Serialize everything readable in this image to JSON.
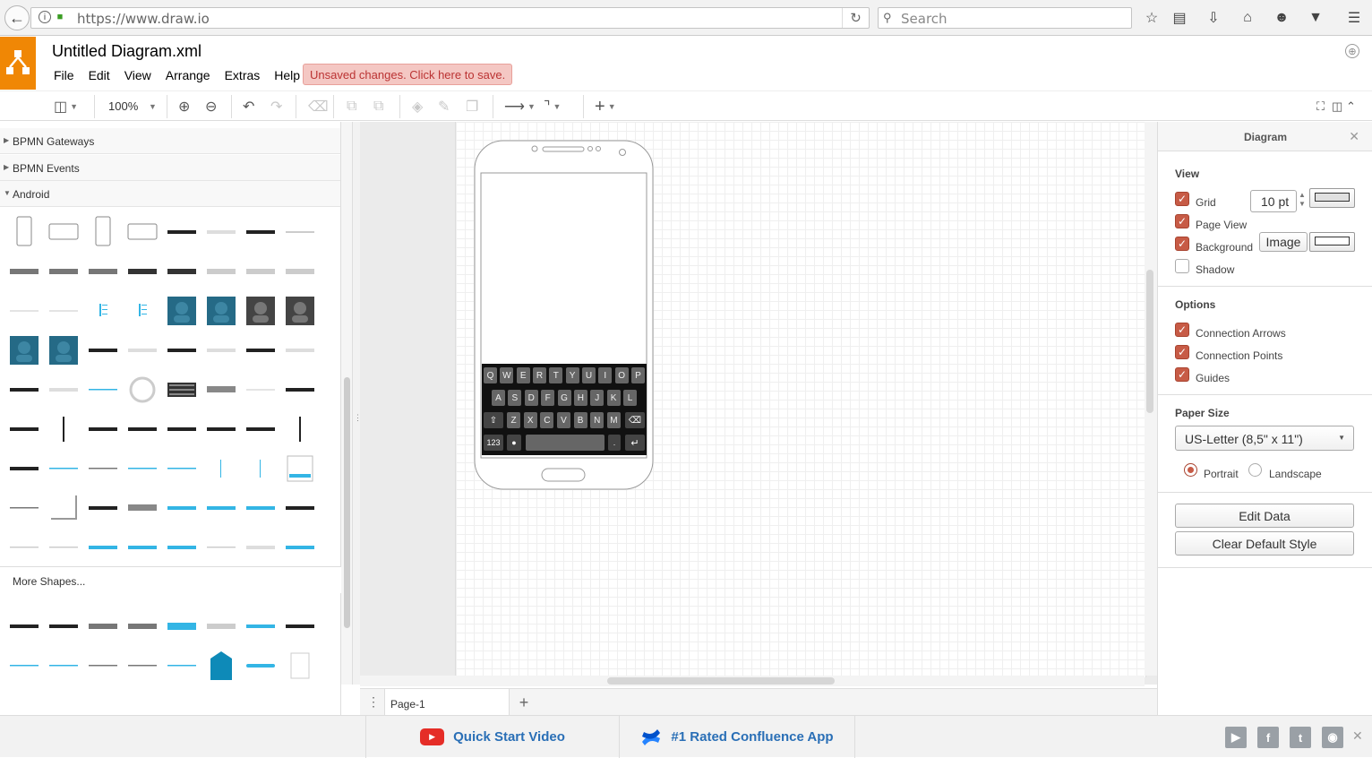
{
  "browser": {
    "url": "https://www.draw.io",
    "search_placeholder": "Search"
  },
  "app": {
    "document_title": "Untitled Diagram.xml",
    "menu": [
      "File",
      "Edit",
      "View",
      "Arrange",
      "Extras",
      "Help"
    ],
    "unsaved_notice": "Unsaved changes. Click here to save."
  },
  "toolbar": {
    "zoom": "100%"
  },
  "sidebar": {
    "sections": [
      {
        "label": "BPMN Gateways",
        "expanded": false
      },
      {
        "label": "BPMN Events",
        "expanded": false
      },
      {
        "label": "Android",
        "expanded": true
      }
    ],
    "more_shapes": "More Shapes..."
  },
  "keyboard": {
    "row1": [
      "Q",
      "W",
      "E",
      "R",
      "T",
      "Y",
      "U",
      "I",
      "O",
      "P"
    ],
    "row2": [
      "A",
      "S",
      "D",
      "F",
      "G",
      "H",
      "J",
      "K",
      "L"
    ],
    "row3": [
      "Z",
      "X",
      "C",
      "V",
      "B",
      "N",
      "M"
    ],
    "numkey": "123"
  },
  "pages": {
    "current": "Page-1"
  },
  "panel": {
    "title": "Diagram",
    "view_heading": "View",
    "grid_label": "Grid",
    "grid_size": "10 pt",
    "page_view_label": "Page View",
    "background_label": "Background",
    "image_button": "Image",
    "shadow_label": "Shadow",
    "options_heading": "Options",
    "connection_arrows_label": "Connection Arrows",
    "connection_points_label": "Connection Points",
    "guides_label": "Guides",
    "paper_size_heading": "Paper Size",
    "paper_size_value": "US-Letter (8,5\" x 11\")",
    "portrait_label": "Portrait",
    "landscape_label": "Landscape",
    "edit_data_button": "Edit Data",
    "clear_style_button": "Clear Default Style"
  },
  "footer": {
    "quick_start": "Quick Start Video",
    "confluence": "#1 Rated Confluence App"
  },
  "colors": {
    "brand_orange": "#f08705",
    "checkbox_red": "#c75b46",
    "promo_blue": "#2a6fb6",
    "youtube_red": "#e52d27"
  }
}
